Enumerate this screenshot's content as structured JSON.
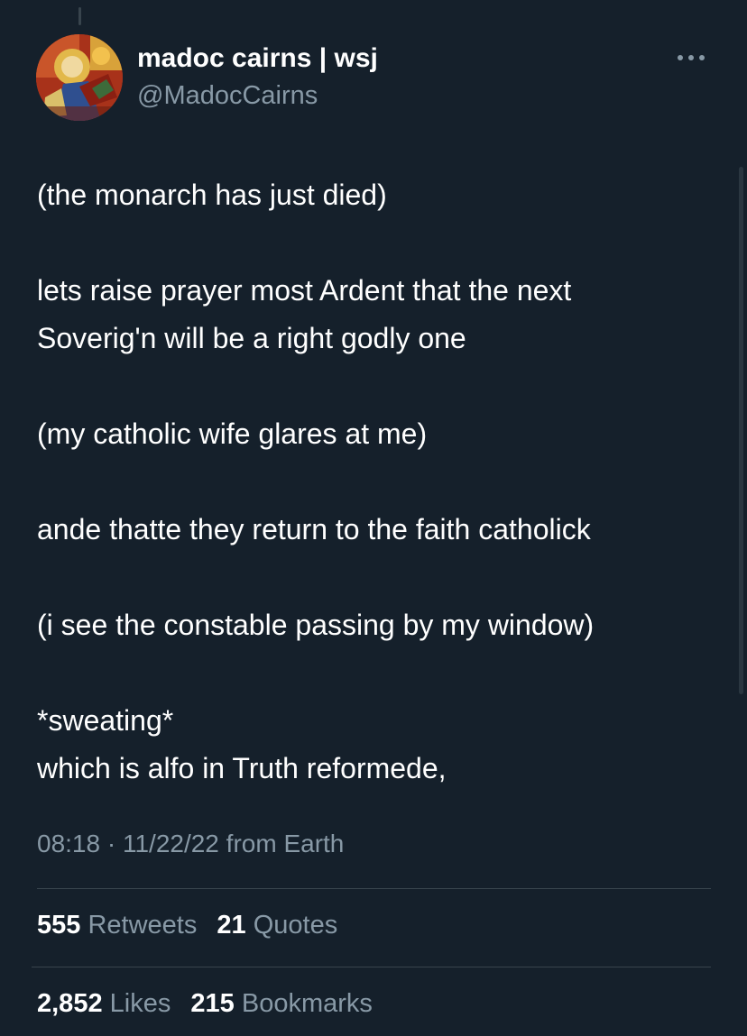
{
  "author": {
    "display_name": "madoc cairns | wsj",
    "handle": "@MadocCairns",
    "avatar_icon": "avatar-painting"
  },
  "more_icon": "more-horizontal-icon",
  "tweet": {
    "paragraphs": [
      [
        "(the monarch has just died)"
      ],
      [
        "lets raise prayer most Ardent that the next",
        "Soverig'n will be a right godly one"
      ],
      [
        "(my catholic wife glares at me)"
      ],
      [
        "ande thatte they return to the faith catholick"
      ],
      [
        "(i see the constable passing by my window)"
      ],
      [
        "*sweating*",
        "which is alfo in Truth reformede,"
      ]
    ]
  },
  "meta": {
    "time": "08:18",
    "separator": "·",
    "date": "11/22/22",
    "source": "from Earth"
  },
  "stats": {
    "retweets": {
      "count": "555",
      "label": "Retweets"
    },
    "quotes": {
      "count": "21",
      "label": "Quotes"
    },
    "likes": {
      "count": "2,852",
      "label": "Likes"
    },
    "bookmarks": {
      "count": "215",
      "label": "Bookmarks"
    }
  },
  "colors": {
    "background": "#15202b",
    "text_primary": "#ffffff",
    "text_secondary": "#8899a6",
    "divider": "#38444d"
  }
}
